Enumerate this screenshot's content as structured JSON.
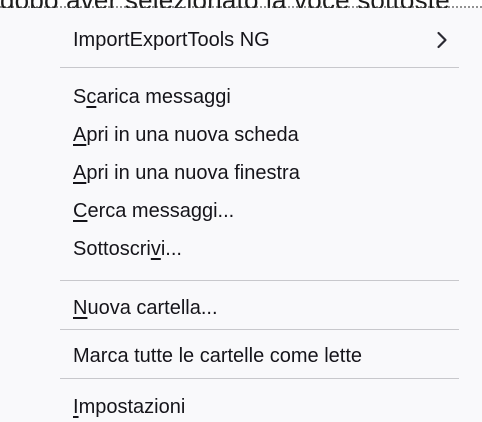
{
  "background_text": "dopo aver selezionato la voce sottoste",
  "menu": {
    "submenu_item": {
      "label": "ImportExportTools NG",
      "arrow_icon": "chevron-right-icon"
    },
    "items": [
      {
        "pre": "S",
        "acc": "c",
        "post": "arica messaggi"
      },
      {
        "pre": "",
        "acc": "A",
        "post": "pri in una nuova scheda"
      },
      {
        "pre": "",
        "acc": "A",
        "post": "pri in una nuova finestra"
      },
      {
        "pre": "",
        "acc": "C",
        "post": "erca messaggi..."
      },
      {
        "pre": "Sottoscri",
        "acc": "v",
        "post": "i..."
      },
      {
        "pre": "",
        "acc": "N",
        "post": "uova cartella..."
      },
      {
        "pre": "Marca tutte le cartelle come lette",
        "acc": "",
        "post": ""
      },
      {
        "pre": "",
        "acc": "I",
        "post": "mpostazioni"
      }
    ]
  }
}
